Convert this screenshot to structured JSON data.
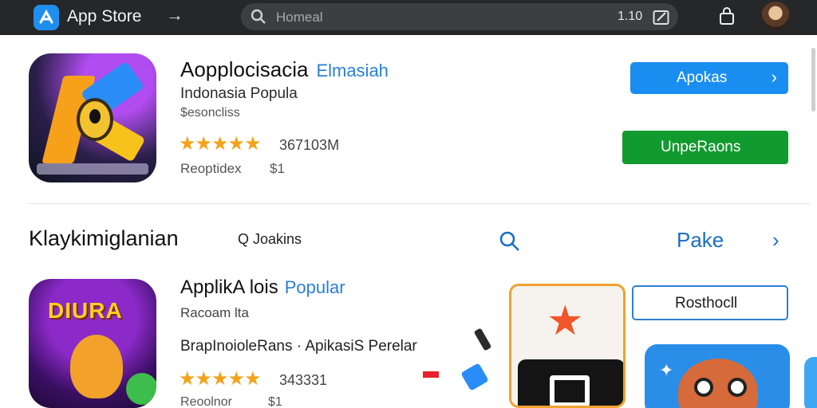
{
  "topbar": {
    "app_name": "App Store",
    "forward_glyph": "→",
    "search_placeholder": "Homeal",
    "search_count": "1.10"
  },
  "hero": {
    "title": "Aopplocisacia",
    "title_accent": "Elmasiah",
    "subtitle": "Indonasia Popula",
    "developer": "$esoncliss",
    "stars": "★★★★★",
    "rating_count": "367103M",
    "price_label": "Reoptidex",
    "price": "$1",
    "primary_button": "Apokas",
    "primary_chevron": "›",
    "secondary_button": "UnpeRaons"
  },
  "section": {
    "title": "Klaykimiglanian",
    "search_label": "Q Joakins",
    "more_label": "Pake",
    "more_chevron": "›"
  },
  "app2": {
    "icon_word": "DIURA",
    "title": "ApplikA lois",
    "title_accent": "Popular",
    "subtitle": "Racoam lta",
    "description": "BrapInoioleRans · ApikasiS Perelar",
    "stars": "★★★★★",
    "rating_count": "343331",
    "price_label": "Reoolnor",
    "price": "$1"
  },
  "featured": {
    "outline_button": "Rosthocll"
  },
  "colors": {
    "topbar_bg": "#262728",
    "accent_blue": "#1a8ef0",
    "accent_green": "#119a2e",
    "link_blue": "#1a6fc4",
    "star": "#f3a31b"
  },
  "icons": {
    "app_logo": "app-store-icon",
    "forward": "arrow-right-icon",
    "search": "search-icon",
    "edit": "edit-icon",
    "lock": "lock-icon",
    "avatar": "user-avatar"
  }
}
